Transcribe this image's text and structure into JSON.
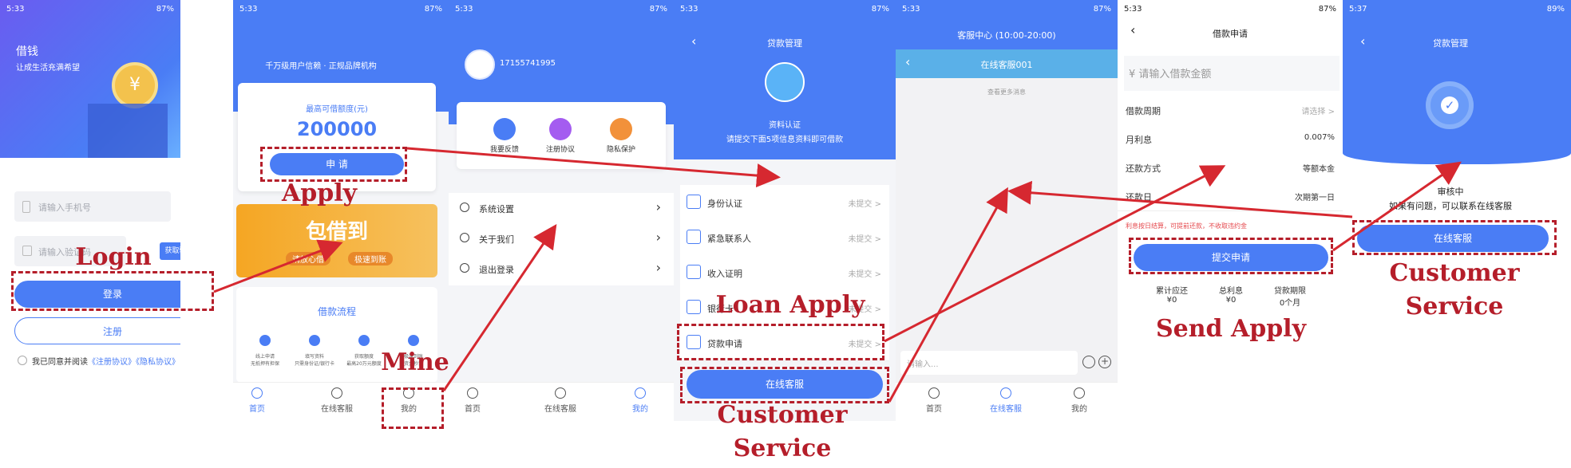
{
  "status": {
    "s1": {
      "time": "5:33",
      "batt": "87%"
    },
    "s2": {
      "time": "5:33",
      "batt": "87%"
    },
    "s3": {
      "time": "5:33",
      "batt": "87%"
    },
    "s4": {
      "time": "5:33",
      "batt": "87%"
    },
    "s5": {
      "time": "5:33",
      "batt": "87%"
    },
    "s6": {
      "time": "5:33",
      "batt": "87%"
    },
    "s7": {
      "time": "5:37",
      "batt": "89%"
    }
  },
  "login": {
    "title": "借钱",
    "subtitle": "让成生活充满希望",
    "phone_placeholder": "请输入手机号",
    "code_placeholder": "请输入验证码",
    "get_code": "获取验证码",
    "login_btn": "登录",
    "register_btn": "注册",
    "agree_prefix": "我已同意并阅读",
    "agree_link1": "《注册协议》",
    "agree_link2": "《隐私协议》"
  },
  "home": {
    "slogan": "千万级用户信赖 · 正规品牌机构",
    "credit_label": "最高可借额度(元)",
    "credit_value": "200000",
    "apply_btn": "申 请",
    "banner_title": "包借到",
    "banner_left": "请放心借",
    "banner_right": "极速到账",
    "process_title": "借款流程",
    "steps": [
      {
        "t": "线上申请",
        "d": "无抵押有担保"
      },
      {
        "t": "填写资料",
        "d": "只需身份证/银行卡"
      },
      {
        "t": "获取额度",
        "d": "最高20万元额度"
      },
      {
        "t": "极速到账",
        "d": "资金秒到"
      }
    ],
    "tabs": [
      "首页",
      "在线客服",
      "我的"
    ]
  },
  "mine": {
    "phone": "17155741995",
    "quick": [
      "我要反馈",
      "注册协议",
      "隐私保护"
    ],
    "menu": [
      "系统设置",
      "关于我们",
      "退出登录"
    ],
    "tabs": [
      "首页",
      "在线客服",
      "我的"
    ]
  },
  "loan": {
    "nav_title": "贷款管理",
    "info_title": "资料认证",
    "info_desc": "请提交下面5项信息资料即可借款",
    "items": [
      {
        "label": "身份认证",
        "status": "未提交 >"
      },
      {
        "label": "紧急联系人",
        "status": "未提交 >"
      },
      {
        "label": "收入证明",
        "status": "未提交 >"
      },
      {
        "label": "银行卡",
        "status": "未提交 >"
      },
      {
        "label": "贷款申请",
        "status": "未提交 >"
      }
    ],
    "service_btn": "在线客服"
  },
  "chat": {
    "header": "客服中心 (10:00-20:00)",
    "agent": "在线客服001",
    "more": "查看更多消息",
    "input_placeholder": "请输入...",
    "tabs": [
      "首页",
      "在线客服",
      "我的"
    ]
  },
  "apply": {
    "nav_title": "借款申请",
    "amount_placeholder": "¥ 请输入借款金额",
    "rows": [
      {
        "label": "借款周期",
        "value": "请选择 >"
      },
      {
        "label": "月利息",
        "value": "0.007%"
      },
      {
        "label": "还款方式",
        "value": "等额本金"
      },
      {
        "label": "还款日",
        "value": "次期第一日"
      }
    ],
    "note": "利息按日结算，可提前还款，不收取违约金",
    "submit_btn": "提交申请",
    "summary": [
      {
        "label": "累计应还",
        "value": "¥0"
      },
      {
        "label": "总利息",
        "value": "¥0"
      },
      {
        "label": "贷款期限",
        "value": "0个月"
      }
    ]
  },
  "review": {
    "nav_title": "贷款管理",
    "status": "审核中",
    "hint": "如果有问题，可以联系在线客服",
    "service_btn": "在线客服"
  },
  "annotations": {
    "login": "Login",
    "apply": "Apply",
    "mine": "Mine",
    "loan_apply": "Loan Apply",
    "customer_service_1": "Customer",
    "customer_service_2": "Service",
    "send_apply": "Send Apply",
    "customer_service_3": "Customer",
    "customer_service_4": "Service",
    "customer_service_5": "Customer",
    "customer_service_6": "Service"
  },
  "colors": {
    "primary": "#4a7df5",
    "annotation": "#b51e2a",
    "warning": "#e5484d"
  }
}
